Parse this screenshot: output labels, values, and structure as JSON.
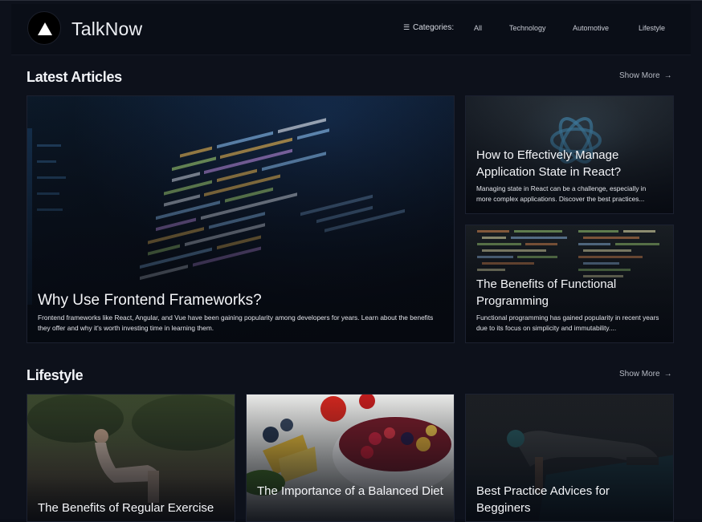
{
  "header": {
    "brand": "TalkNow",
    "categories_label": "Categories:",
    "nav": [
      "All",
      "Technology",
      "Automotive",
      "Lifestyle"
    ]
  },
  "latest": {
    "title": "Latest Articles",
    "show_more": "Show More",
    "featured": {
      "title": "Why Use Frontend Frameworks?",
      "description": "Frontend frameworks like React, Angular, and Vue have been gaining popularity among developers for years. Learn about the benefits they offer and why it's worth investing time in learning them."
    },
    "side": [
      {
        "title": "How to Effectively Manage Application State in React?",
        "description": "Managing state in React can be a challenge, especially in more complex applications. Discover the best practices..."
      },
      {
        "title": "The Benefits of Functional Programming",
        "description": "Functional programming has gained popularity in recent years due to its focus on simplicity and immutability...."
      }
    ]
  },
  "lifestyle": {
    "title": "Lifestyle",
    "show_more": "Show More",
    "cards": [
      {
        "title": "The Benefits of Regular Exercise"
      },
      {
        "title": "The Importance of a Balanced Diet"
      },
      {
        "title": "Best Practice Advices for Begginers"
      }
    ]
  },
  "colors": {
    "background": "#0d111b",
    "header": "#0a0e17",
    "text": "#f4f5f8",
    "muted": "#b6bac4"
  }
}
